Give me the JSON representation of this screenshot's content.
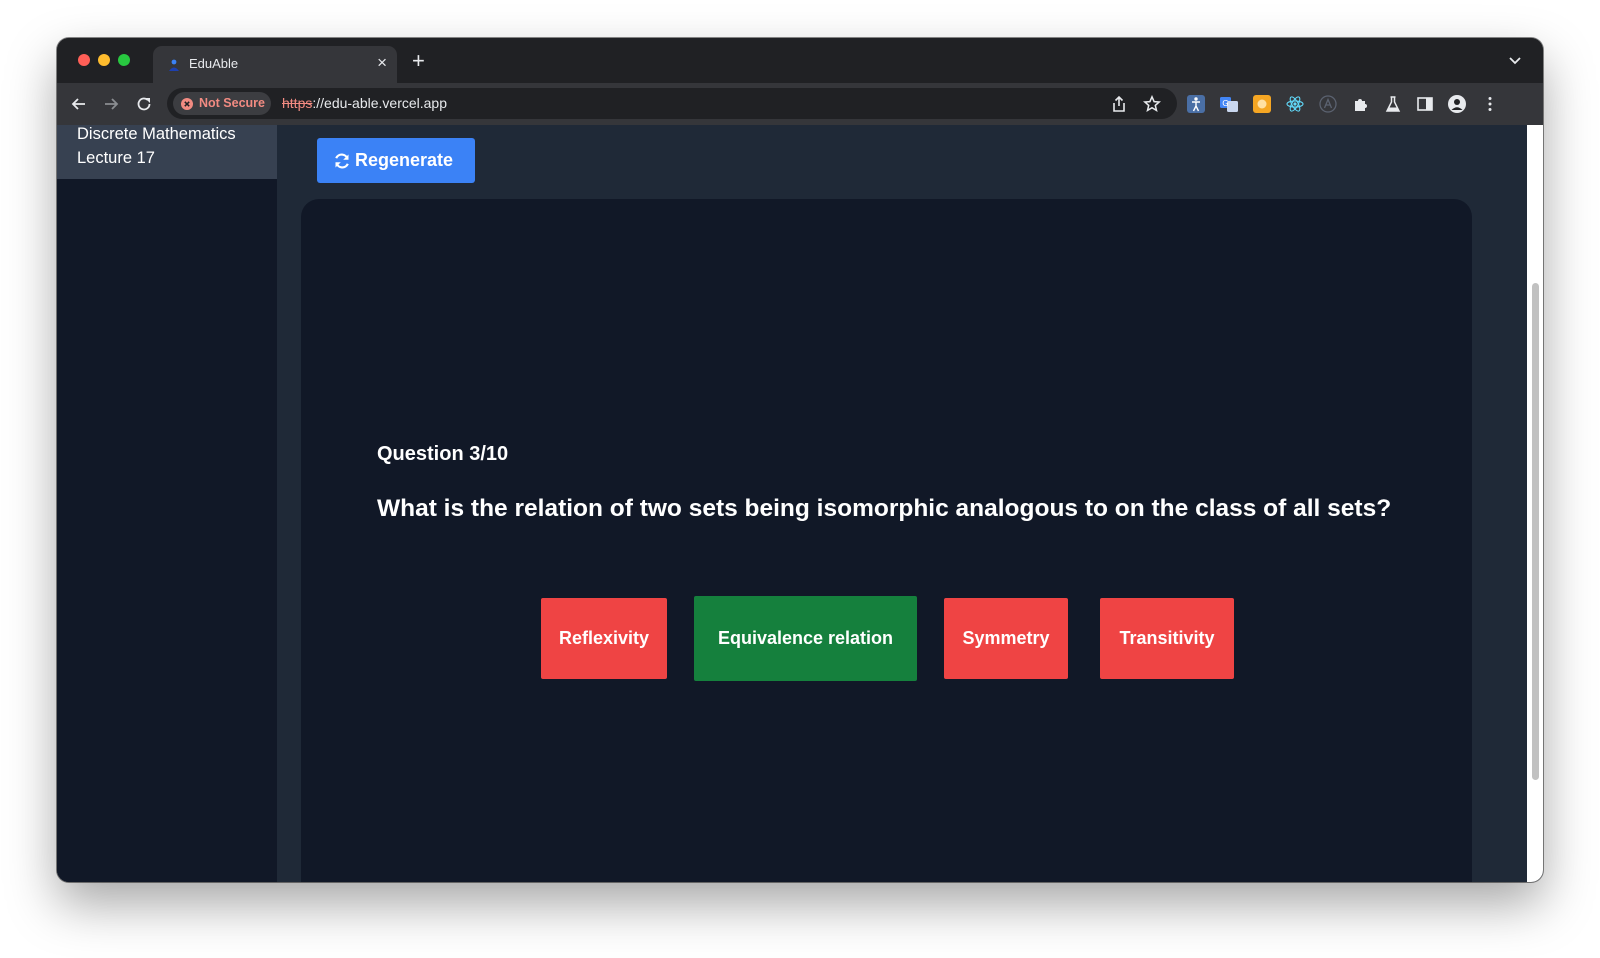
{
  "browser": {
    "tab_title": "EduAble",
    "tab_close": "×",
    "new_tab": "+",
    "security_label": "Not Secure",
    "url_scheme": "https",
    "url_rest": "://edu-able.vercel.app"
  },
  "sidebar": {
    "items": [
      {
        "label": "Discrete Mathematics Lecture 17",
        "active": true
      }
    ]
  },
  "main": {
    "regenerate_label": "Regenerate",
    "question_counter": "Question 3/10",
    "question_text": "What is the relation of two sets being isomorphic analogous to on the class of all sets?",
    "answers": [
      {
        "label": "Reflexivity",
        "state": "incorrect",
        "color": "#ef4444"
      },
      {
        "label": "Equivalence relation",
        "state": "correct",
        "color": "#15803d"
      },
      {
        "label": "Symmetry",
        "state": "incorrect",
        "color": "#ef4444"
      },
      {
        "label": "Transitivity",
        "state": "incorrect",
        "color": "#ef4444"
      }
    ]
  },
  "colors": {
    "accent": "#3b82f6",
    "page_bg": "#1f2937",
    "card_bg": "#111827",
    "correct": "#15803d",
    "incorrect": "#ef4444"
  },
  "icons": {
    "nav": [
      "back-arrow-icon",
      "forward-arrow-icon",
      "reload-icon"
    ],
    "omnibox": [
      "share-icon",
      "bookmark-star-icon"
    ],
    "extensions": [
      "accessibility-extension-icon",
      "translate-extension-icon",
      "orange-extension-icon",
      "react-devtools-icon",
      "a-circle-extension-icon",
      "puzzle-extensions-icon",
      "flask-labs-icon",
      "side-panel-icon",
      "profile-avatar-icon",
      "kebab-menu-icon"
    ],
    "regenerate": "refresh-icon"
  }
}
